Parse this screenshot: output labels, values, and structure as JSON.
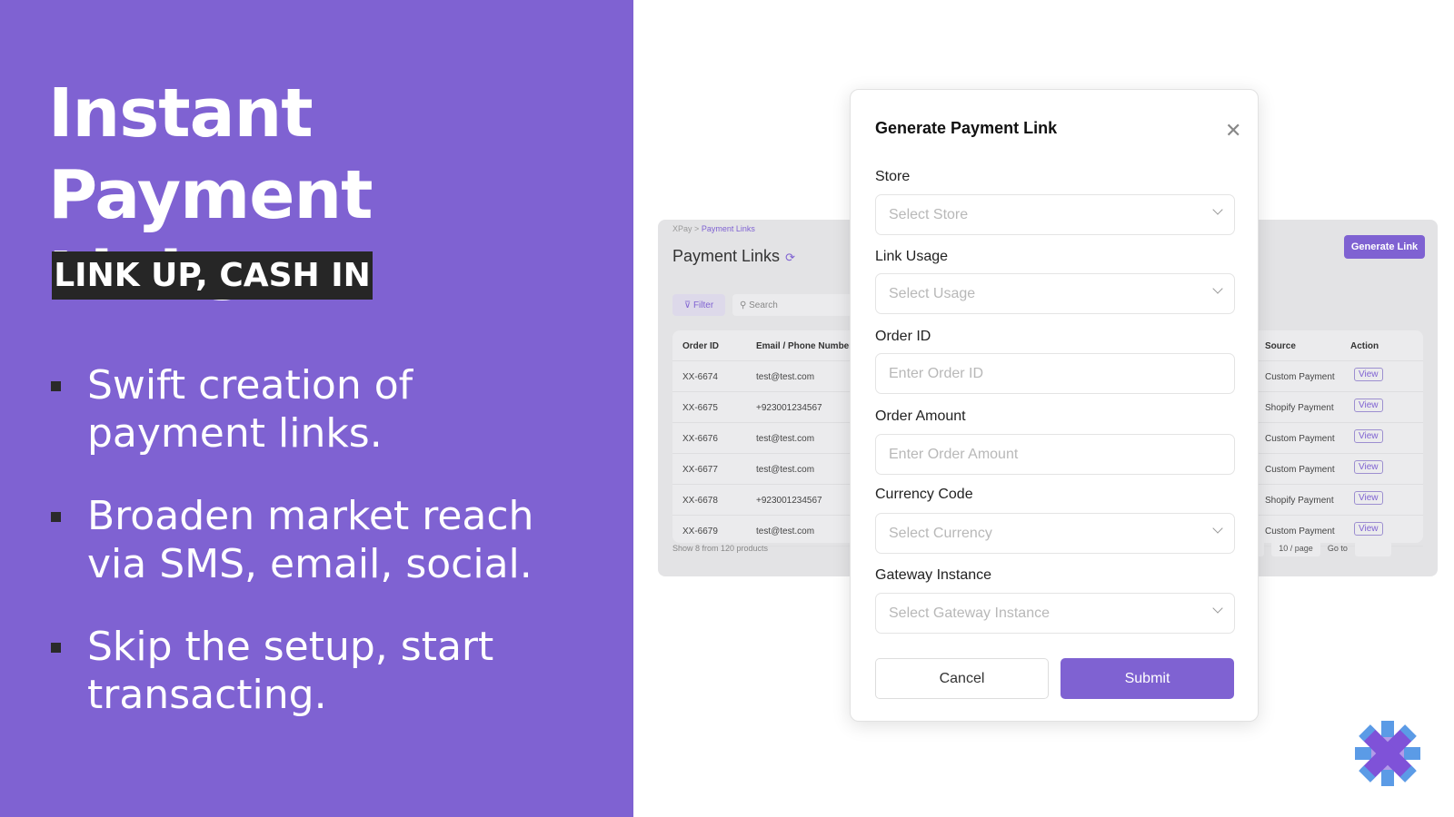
{
  "hero": {
    "title_line1": "Instant Payment",
    "title_line2": "Links",
    "tagline": "LINK UP, CASH IN",
    "bullets": [
      [
        "Swift creation of",
        "payment links."
      ],
      [
        "Broaden market reach",
        "via SMS, email, social."
      ],
      [
        "Skip the setup, start",
        "transacting."
      ]
    ]
  },
  "background_page": {
    "breadcrumb_root": "XPay",
    "breadcrumb_sep": ">",
    "breadcrumb_current": "Payment Links",
    "title": "Payment Links",
    "refresh_icon": "refresh-icon",
    "generate_button": "Generate Link",
    "filter_label": "Filter",
    "search_placeholder": "Search",
    "columns": [
      "Order ID",
      "Email / Phone Number",
      "Source",
      "Action"
    ],
    "rows": [
      {
        "id": "XX-6674",
        "contact": "test@test.com",
        "source": "Custom Payment",
        "action": "View"
      },
      {
        "id": "XX-6675",
        "contact": "+923001234567",
        "source": "Shopify Payment",
        "action": "View"
      },
      {
        "id": "XX-6676",
        "contact": "test@test.com",
        "source": "Custom Payment",
        "action": "View"
      },
      {
        "id": "XX-6677",
        "contact": "test@test.com",
        "source": "Custom Payment",
        "action": "View"
      },
      {
        "id": "XX-6678",
        "contact": "+923001234567",
        "source": "Shopify Payment",
        "action": "View"
      },
      {
        "id": "XX-6679",
        "contact": "test@test.com",
        "source": "Custom Payment",
        "action": "View"
      }
    ],
    "footer": "Show 8 from 120 products",
    "pager_next": ">",
    "page_size": "10 / page",
    "goto_label": "Go to"
  },
  "modal": {
    "title": "Generate Payment Link",
    "fields": [
      {
        "label": "Store",
        "placeholder": "Select Store"
      },
      {
        "label": "Link Usage",
        "placeholder": "Select Usage"
      },
      {
        "label": "Order ID",
        "placeholder": "Enter Order ID"
      },
      {
        "label": "Order Amount",
        "placeholder": "Enter Order Amount"
      },
      {
        "label": "Currency Code",
        "placeholder": "Select Currency"
      },
      {
        "label": "Gateway Instance",
        "placeholder": "Select Gateway Instance"
      }
    ],
    "cancel": "Cancel",
    "submit": "Submit"
  },
  "colors": {
    "accent": "#7f62d2",
    "badge": "#262626"
  }
}
